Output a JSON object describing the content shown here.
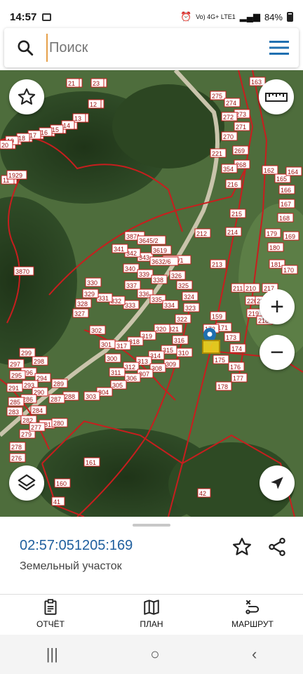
{
  "status_bar": {
    "time": "14:57",
    "network": "Vo) 4G+ LTE1",
    "battery": "84%"
  },
  "search": {
    "placeholder": "Поиск"
  },
  "map": {
    "parcel_labels": [
      "234",
      "235",
      "230",
      "229",
      "228",
      "227",
      "226",
      "225",
      "224",
      "223",
      "222",
      "221",
      "355",
      "3610",
      "349",
      "347",
      "346",
      "345",
      "344",
      "343",
      "342",
      "341",
      "340",
      "339",
      "338",
      "337",
      "336",
      "335",
      "334",
      "333",
      "332",
      "331",
      "330",
      "329",
      "328",
      "327",
      "326",
      "325",
      "324",
      "323",
      "322",
      "321",
      "320",
      "319",
      "318",
      "317",
      "316",
      "315",
      "314",
      "313",
      "312",
      "311",
      "310",
      "309",
      "308",
      "307",
      "306",
      "305",
      "304",
      "303",
      "302",
      "301",
      "300",
      "299",
      "298",
      "297",
      "296",
      "295",
      "294",
      "293",
      "291",
      "290",
      "289",
      "288",
      "287",
      "286",
      "285",
      "284",
      "283",
      "282",
      "281",
      "280",
      "279",
      "278",
      "277",
      "276",
      "275",
      "274",
      "273",
      "272",
      "271",
      "270",
      "269",
      "268",
      "354",
      "221",
      "216",
      "215",
      "214",
      "213",
      "212",
      "211",
      "210",
      "220",
      "219",
      "218",
      "217",
      "222",
      "159",
      "171",
      "172",
      "173",
      "174",
      "175",
      "176",
      "177",
      "178",
      "179",
      "180",
      "181",
      "170",
      "169",
      "168",
      "167",
      "166",
      "165",
      "164",
      "163",
      "162",
      "161",
      "160",
      "41",
      "42",
      "21",
      "23",
      "12",
      "13",
      "14",
      "15",
      "16",
      "17",
      "18",
      "19",
      "20",
      "11",
      "1929",
      "3870",
      "3871",
      "3645/2",
      "3619",
      "3645/1",
      "3632/6"
    ],
    "colors": {
      "boundary": "#c81e1e",
      "label_text": "#a01010",
      "label_bg": "#ffffff",
      "road": "#c7c1a8",
      "forest": "#2f4a25",
      "meadow": "#5a7a44"
    }
  },
  "controls": {
    "favorite_icon": "star-outline-icon",
    "ruler_icon": "ruler-icon",
    "zoom_in": "+",
    "zoom_out": "−",
    "layers_icon": "layers-icon",
    "locate_icon": "navigation-arrow-icon"
  },
  "panel": {
    "cadastral_number": "02:57:051205:169",
    "type": "Земельный участок",
    "favorite_icon": "star-outline-icon",
    "share_icon": "share-icon"
  },
  "actions": [
    {
      "label": "ОТЧЁТ",
      "icon": "report-icon"
    },
    {
      "label": "ПЛАН",
      "icon": "map-plan-icon"
    },
    {
      "label": "МАРШРУТ",
      "icon": "route-icon"
    }
  ],
  "system_nav": {
    "recent": "|||",
    "home": "○",
    "back": "‹"
  }
}
